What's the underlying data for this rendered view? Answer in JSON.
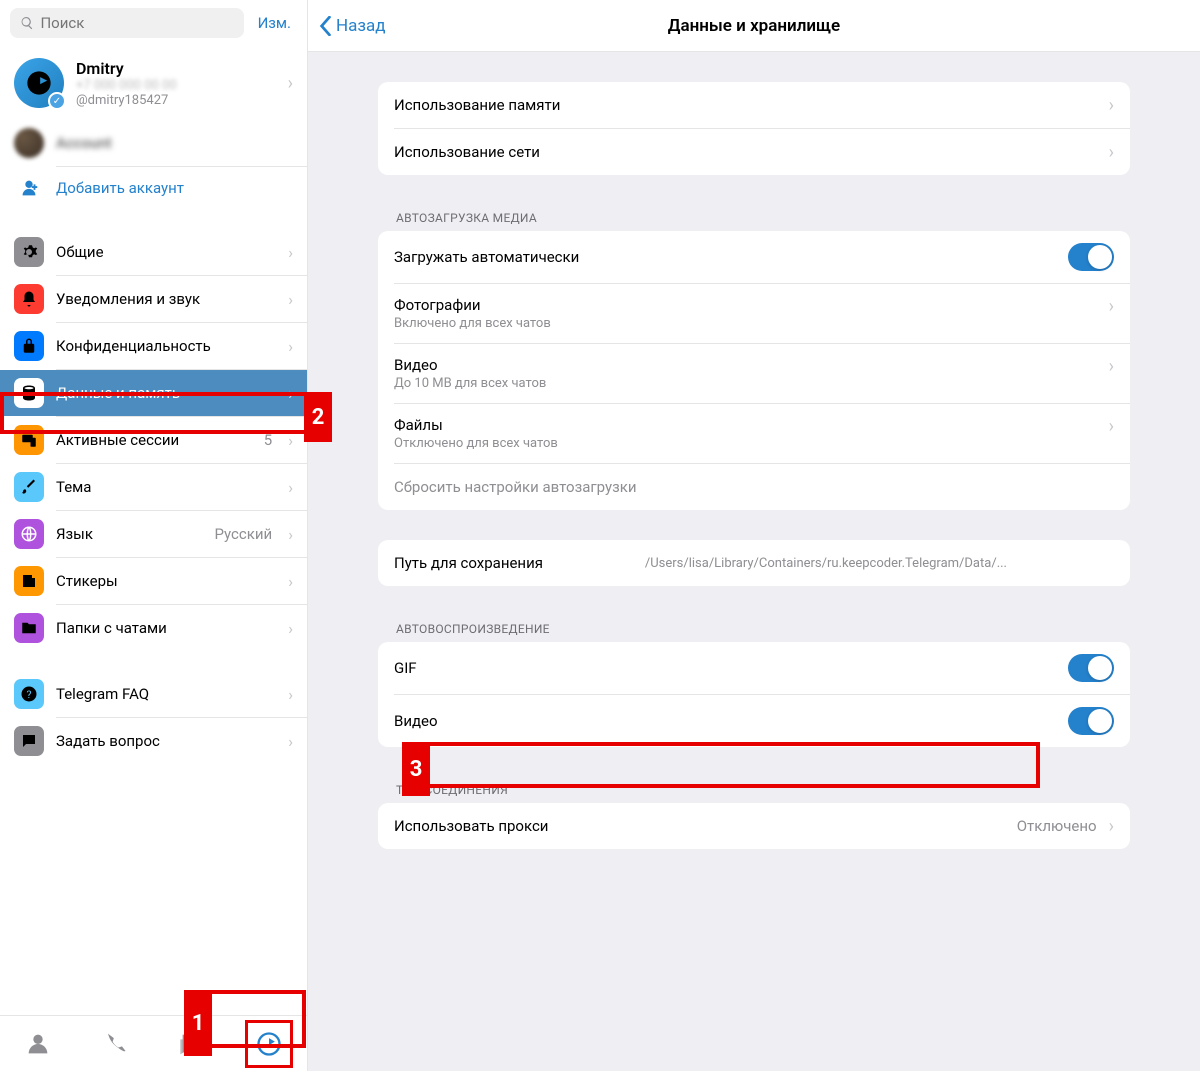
{
  "sidebar": {
    "search_placeholder": "Поиск",
    "edit": "Изм.",
    "profile": {
      "name": "Dmitry",
      "username": "@dmitry185427"
    },
    "add_account": "Добавить аккаунт",
    "items": [
      {
        "label": "Общие"
      },
      {
        "label": "Уведомления и звук"
      },
      {
        "label": "Конфиденциальность"
      },
      {
        "label": "Данные и память"
      },
      {
        "label": "Активные сессии",
        "value": "5"
      },
      {
        "label": "Тема"
      },
      {
        "label": "Язык",
        "value": "Русский"
      },
      {
        "label": "Стикеры"
      },
      {
        "label": "Папки с чатами"
      }
    ],
    "items2": [
      {
        "label": "Telegram FAQ"
      },
      {
        "label": "Задать вопрос"
      }
    ]
  },
  "main": {
    "back": "Назад",
    "title": "Данные и хранилище",
    "storage": {
      "memory": "Использование памяти",
      "network": "Использование сети"
    },
    "auto_media_header": "АВТОЗАГРУЗКА МЕДИА",
    "auto_media": {
      "auto_download": "Загружать автоматически",
      "photos": "Фотографии",
      "photos_sub": "Включено для всех чатов",
      "videos": "Видео",
      "videos_sub": "До 10 MB для всех чатов",
      "files": "Файлы",
      "files_sub": "Отключено для всех чатов",
      "reset": "Сбросить настройки автозагрузки"
    },
    "save_path": {
      "label": "Путь для сохранения",
      "value": "/Users/lisa/Library/Containers/ru.keepcoder.Telegram/Data/..."
    },
    "autoplay_header": "АВТОВОСПРОИЗВЕДЕНИЕ",
    "autoplay": {
      "gif": "GIF",
      "video": "Видео"
    },
    "conn_header": "ТИП СОЕДИНЕНИЯ",
    "proxy": {
      "label": "Использовать прокси",
      "value": "Отключено"
    }
  }
}
